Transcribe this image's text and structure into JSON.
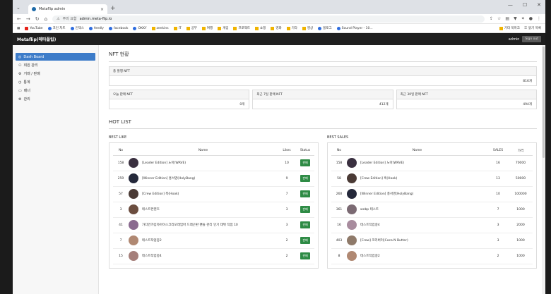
{
  "browser": {
    "tab_title": "Metaflip admin",
    "url_warning": "주의 요함",
    "url": "admin.meta-flip.io",
    "bookmarks": [
      "YouTube",
      "코인 차트",
      "인덱스",
      "feedly",
      "facebook",
      "OKKY",
      "zenkins",
      "IT",
      "공부",
      "여행",
      "게임",
      "프로젝트",
      "쇼핑",
      "영화",
      "기타",
      "영상",
      "블로그",
      "Sound Player - 10..."
    ],
    "bookmarks_right": "기타 북마크",
    "reading_list": "읽기 목록"
  },
  "header": {
    "brand": "Metaflip(메타플립)",
    "user": "admin",
    "signout": "Sign out"
  },
  "sidebar": {
    "items": [
      {
        "label": "Dash Board",
        "icon": "dashboard-icon"
      },
      {
        "label": "회원 관리",
        "icon": "user-icon"
      },
      {
        "label": "거래 / 판매",
        "icon": "trade-icon"
      },
      {
        "label": "통계",
        "icon": "stats-icon"
      },
      {
        "label": "배너",
        "icon": "banner-icon"
      },
      {
        "label": "관리",
        "icon": "settings-icon"
      }
    ]
  },
  "main": {
    "nft_title": "NFT 현황",
    "total": {
      "label": "총 발행 NFT",
      "value": "816개"
    },
    "stats": [
      {
        "label": "오늘 판매 NFT",
        "value": "0개"
      },
      {
        "label": "최근 7일 판매 NFT",
        "value": "412개"
      },
      {
        "label": "최근 30일 판매 NFT",
        "value": "494개"
      }
    ],
    "hot_title": "HOT LIST",
    "best_like": {
      "title": "BEST LIKE",
      "headers": [
        "No",
        "Name",
        "Likes",
        "Status"
      ],
      "rows": [
        {
          "no": "158",
          "name": "[Leader Edition] 노아(WAVE)",
          "likes": "10",
          "status": "판매",
          "color": "#3a3040"
        },
        {
          "no": "259",
          "name": "[Winner Edition] 홍서영(HolyBang)",
          "likes": "9",
          "status": "판매",
          "color": "#24283a"
        },
        {
          "no": "57",
          "name": "[Crew Edition] 훅(Hook)",
          "likes": "7",
          "status": "판매",
          "color": "#4a3a35"
        },
        {
          "no": "3",
          "name": "테스트컨텐츠",
          "likes": "3",
          "status": "판매",
          "color": "#6b4d3f"
        },
        {
          "no": "41",
          "name": "가디언가입자아이스크리모래엄마 드래곤판 팬들 관리 인기 데뷔 작점 10",
          "likes": "3",
          "status": "판매",
          "color": "#8a6a8f"
        },
        {
          "no": "7",
          "name": "테스트작업중2",
          "likes": "2",
          "status": "판매",
          "color": "#b08872"
        },
        {
          "no": "15",
          "name": "테스트작업중4",
          "likes": "2",
          "status": "판매",
          "color": "#a57f7a"
        }
      ]
    },
    "best_sales": {
      "title": "BEST SALES",
      "headers": [
        "No",
        "Name",
        "SALES",
        "가격"
      ],
      "rows": [
        {
          "no": "158",
          "name": "[Leader Edition] 노아(WAVE)",
          "sales": "16",
          "price": "70000",
          "color": "#3a3040"
        },
        {
          "no": "58",
          "name": "[Crew Edition] 훅(Hook)",
          "sales": "13",
          "price": "50000",
          "color": "#4a3a35"
        },
        {
          "no": "260",
          "name": "[Winner Edition] 홍서영(HolyBang)",
          "sales": "10",
          "price": "100000",
          "color": "#24283a"
        },
        {
          "no": "361",
          "name": "webp 테스트",
          "sales": "7",
          "price": "1000",
          "color": "#7b6a73"
        },
        {
          "no": "16",
          "name": "테스트작업중4",
          "sales": "3",
          "price": "2000",
          "color": "#a88c9e"
        },
        {
          "no": "403",
          "name": "[Crew] 코카버터(Coca N Butter)",
          "sales": "3",
          "price": "1000",
          "color": "#8f7a6a"
        },
        {
          "no": "8",
          "name": "테스트작업중2",
          "sales": "2",
          "price": "1000",
          "color": "#b08872"
        }
      ]
    }
  }
}
